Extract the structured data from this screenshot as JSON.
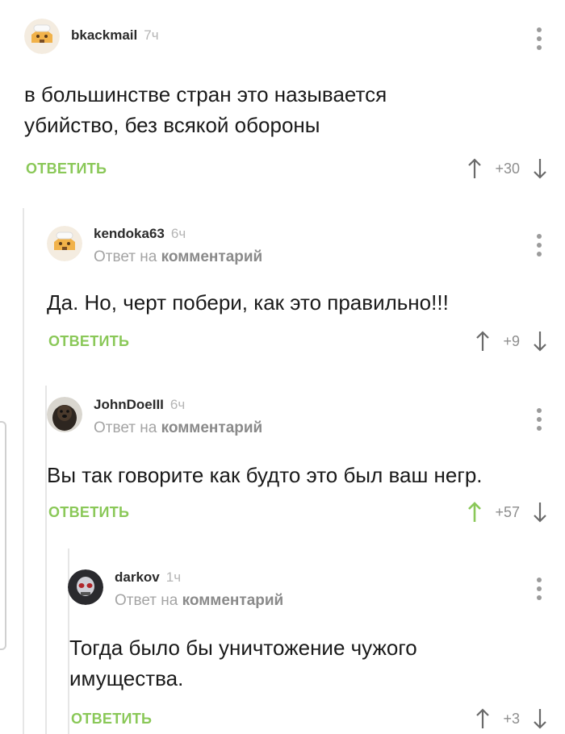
{
  "comments": [
    {
      "username": "bkackmail",
      "time": "7ч",
      "text_lines": [
        "в большинстве стран это называется",
        "убийство, без всякой обороны"
      ],
      "reply_label": "ОТВЕТИТЬ",
      "score": "+30",
      "upvoted": false
    },
    {
      "username": "kendoka63",
      "time": "6ч",
      "reply_prefix": "Ответ на",
      "reply_target": "комментарий",
      "text_lines": [
        "Да. Но, черт побери, как это правильно!!!"
      ],
      "reply_label": "ОТВЕТИТЬ",
      "score": "+9",
      "upvoted": false
    },
    {
      "username": "JohnDoeIII",
      "time": "6ч",
      "reply_prefix": "Ответ на",
      "reply_target": "комментарий",
      "text_lines": [
        "Вы так говорите как будто это был ваш негр."
      ],
      "reply_label": "ОТВЕТИТЬ",
      "score": "+57",
      "upvoted": true
    },
    {
      "username": "darkov",
      "time": "1ч",
      "reply_prefix": "Ответ на",
      "reply_target": "комментарий",
      "text_lines": [
        "Тогда было бы уничтожение чужого",
        "имущества."
      ],
      "reply_label": "ОТВЕТИТЬ",
      "score": "+3",
      "upvoted": false
    }
  ],
  "colors": {
    "accent_green": "#8ac858",
    "arrow_grey": "#6a6a6a",
    "thread_line": "#e6e6e6"
  },
  "icons": {
    "avatar_default": "house-mascot-icon",
    "menu": "more-vertical-icon",
    "upvote": "arrow-up-icon",
    "downvote": "arrow-down-icon"
  }
}
